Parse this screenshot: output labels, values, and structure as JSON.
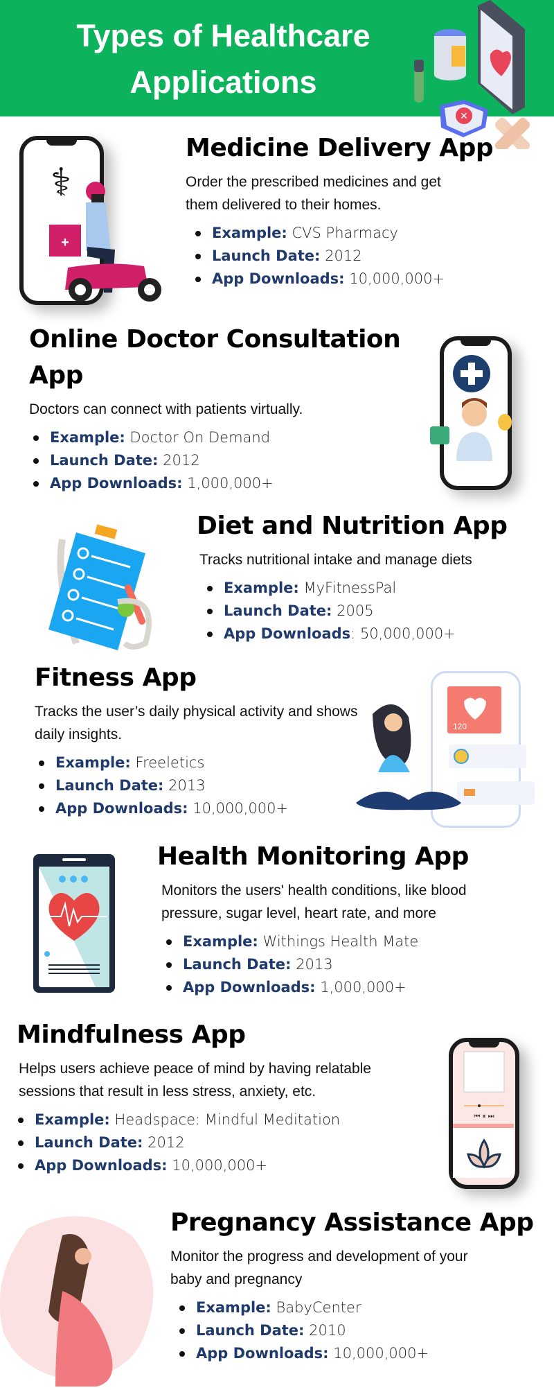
{
  "header": {
    "title_line1": "Types of Healthcare",
    "title_line2": "Applications"
  },
  "colors": {
    "header_bg": "#0db25c",
    "label": "#1f3a6b",
    "title": "#000000"
  },
  "labels": {
    "example": "Example:",
    "launch": "Launch Date:",
    "downloads": "App Downloads:",
    "downloads_plain": "App Downloads",
    "colon": ":"
  },
  "sections": [
    {
      "title": "Medicine Delivery App",
      "desc": "Order the prescribed medicines and get them delivered to their homes.",
      "example": "CVS Pharmacy",
      "launch": "2012",
      "downloads": "10,000,000+",
      "icon": "delivery-scooter-phone-icon"
    },
    {
      "title": "Online Doctor Consultation App",
      "desc": "Doctors can connect with patients virtually.",
      "example": "Doctor On Demand",
      "launch": "2012",
      "downloads": "1,000,000+",
      "icon": "doctor-phone-icon"
    },
    {
      "title": "Diet and Nutrition App",
      "desc": "Tracks nutritional intake and manage diets",
      "example": "MyFitnessPal",
      "launch": "2005",
      "downloads": "50,000,000+",
      "icon": "clipboard-diet-icon"
    },
    {
      "title": "Fitness App",
      "desc": "Tracks the user’s daily physical activity and shows daily insights.",
      "example": "Freeletics",
      "launch": "2013",
      "downloads": "10,000,000+",
      "icon": "yoga-fitness-icon",
      "heart_rate": "120"
    },
    {
      "title": "Health Monitoring App",
      "desc": "Monitors the users' health conditions, like blood pressure, sugar level, heart rate, and more",
      "example": "Withings Health Mate",
      "launch": "2013",
      "downloads": "1,000,000+",
      "icon": "heart-monitor-phone-icon"
    },
    {
      "title": "Mindfulness App",
      "desc": "Helps users achieve peace of mind by having relatable sessions that result in less stress, anxiety, etc.",
      "example": "Headspace: Mindful Meditation",
      "launch": "2012",
      "downloads": "10,000,000+",
      "icon": "lotus-phone-icon"
    },
    {
      "title": "Pregnancy Assistance App",
      "desc": "Monitor the progress and development of your baby and pregnancy",
      "example": "BabyCenter",
      "launch": "2010",
      "downloads": "10,000,000+",
      "icon": "pregnant-woman-icon"
    }
  ]
}
